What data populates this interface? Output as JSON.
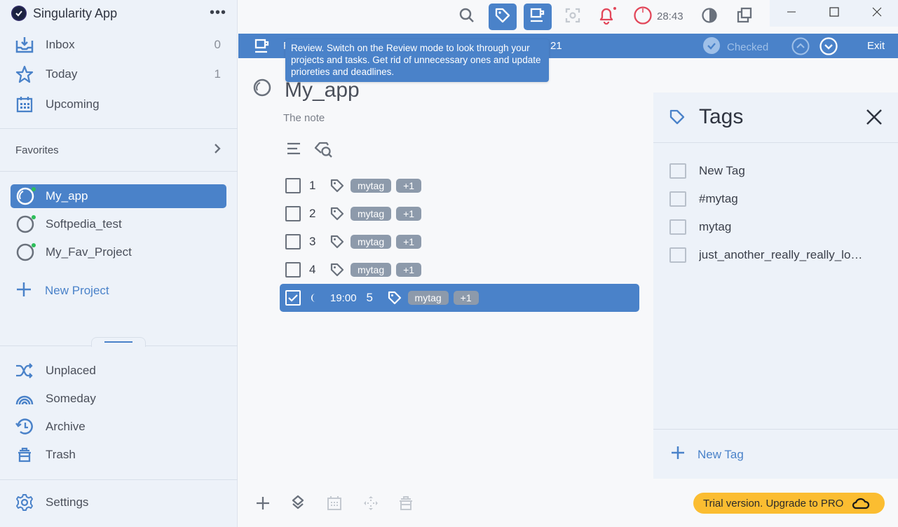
{
  "app": {
    "title": "Singularity App",
    "more_label": "•••"
  },
  "sidebar": {
    "nav": [
      {
        "label": "Inbox",
        "count": "0",
        "icon": "inbox-icon"
      },
      {
        "label": "Today",
        "count": "1",
        "icon": "star-icon"
      },
      {
        "label": "Upcoming",
        "count": "",
        "icon": "calendar-icon"
      }
    ],
    "favorites_label": "Favorites",
    "projects": [
      {
        "label": "My_app",
        "active": true
      },
      {
        "label": "Softpedia_test",
        "active": false
      },
      {
        "label": "My_Fav_Project",
        "active": false
      }
    ],
    "new_project_label": "New Project",
    "bottom_nav": [
      {
        "label": "Unplaced",
        "icon": "shuffle-icon"
      },
      {
        "label": "Someday",
        "icon": "rainbow-icon"
      },
      {
        "label": "Archive",
        "icon": "history-icon"
      },
      {
        "label": "Trash",
        "icon": "trash-icon"
      }
    ],
    "settings_label": "Settings"
  },
  "topbar": {
    "timer": "28:43"
  },
  "review_bar": {
    "label": "R",
    "count": "21",
    "checked_label": "Checked",
    "exit_label": "Exit"
  },
  "tooltip": {
    "text": "Review. Switch on the Review mode to look through your projects and tasks. Get rid of unnecessary ones and update prioreties and deadlines."
  },
  "main": {
    "project_title": "My_app",
    "note": "The note",
    "tasks": [
      {
        "title": "1",
        "tag": "mytag",
        "more_tags": "+1",
        "checked": false,
        "selected": false
      },
      {
        "title": "2",
        "tag": "mytag",
        "more_tags": "+1",
        "checked": false,
        "selected": false
      },
      {
        "title": "3",
        "tag": "mytag",
        "more_tags": "+1",
        "checked": false,
        "selected": false
      },
      {
        "title": "4",
        "tag": "mytag",
        "more_tags": "+1",
        "checked": false,
        "selected": false
      },
      {
        "title": "5",
        "tag": "mytag",
        "more_tags": "+1",
        "checked": true,
        "selected": true,
        "time": "19:00"
      }
    ]
  },
  "tags_panel": {
    "title": "Tags",
    "tags": [
      {
        "label": "New Tag",
        "checked": false
      },
      {
        "label": "#mytag",
        "checked": false
      },
      {
        "label": "mytag",
        "checked": false
      },
      {
        "label": "just_another_really_really_lo…",
        "checked": false
      }
    ],
    "new_tag_label": "New Tag"
  },
  "trial": {
    "label": "Trial version. Upgrade to PRO"
  },
  "colors": {
    "accent": "#4a82c9",
    "sidebar_bg": "#edf2f9",
    "chip": "#8d9aab",
    "trial": "#fbbd31",
    "notify": "#e2475a",
    "online_dot": "#2dbe5a"
  }
}
